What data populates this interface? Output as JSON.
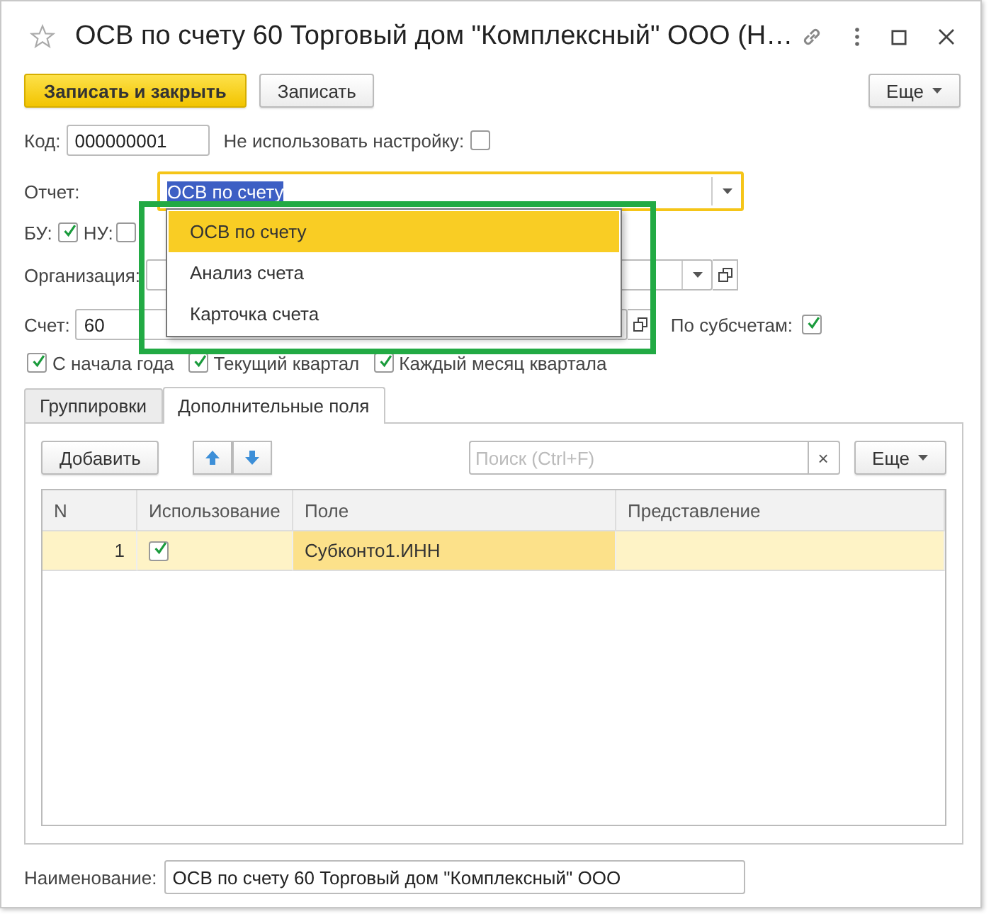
{
  "window": {
    "title": "ОСВ по счету 60 Торговый дом \"Комплексный\" ООО (Н…",
    "favorite": false
  },
  "toolbar": {
    "buttons": [
      {
        "label": "Записать и закрыть",
        "kind": "primary"
      },
      {
        "label": "Записать",
        "kind": "normal"
      }
    ],
    "more": "Еще"
  },
  "code": {
    "label": "Код:",
    "value": "000000001"
  },
  "dont_use": {
    "label": "Не использовать настройку:",
    "checked": false
  },
  "report": {
    "label": "Отчет:",
    "value": "ОСВ по счету"
  },
  "bu": {
    "label": "БУ:",
    "checked": true
  },
  "nu": {
    "label": "НУ:",
    "checked": false
  },
  "organization": {
    "label": "Организация:"
  },
  "account": {
    "label": "Счет:",
    "value": "60"
  },
  "by_subaccounts": {
    "label": "По субсчетам:",
    "checked": true
  },
  "periods": [
    {
      "label": "С начала года",
      "checked": true
    },
    {
      "label": "Текущий квартал",
      "checked": true
    },
    {
      "label": "Каждый месяц квартала",
      "checked": true
    }
  ],
  "tabs": [
    {
      "label": "Группировки",
      "selected": false
    },
    {
      "label": "Дополнительные поля",
      "selected": true
    }
  ],
  "table_toolbar": {
    "add": "Добавить",
    "search": {
      "placeholder": "Поиск (Ctrl+F)"
    },
    "clear": "×",
    "more": "Еще"
  },
  "table": {
    "columns": [
      "N",
      "Использование",
      "Поле",
      "Представление"
    ],
    "rows": [
      {
        "n": "1",
        "use": true,
        "field": "Субконто1.ИНН",
        "presentation": "",
        "selected": true
      }
    ]
  },
  "name": {
    "label": "Наименование:",
    "value": "ОСВ по счету 60 Торговый дом \"Комплексный\" ООО"
  },
  "dropdown": {
    "options": [
      {
        "label": "ОСВ по счету",
        "selected": true
      },
      {
        "label": "Анализ счета",
        "selected": false
      },
      {
        "label": "Карточка счета",
        "selected": false
      }
    ]
  },
  "highlight": true
}
